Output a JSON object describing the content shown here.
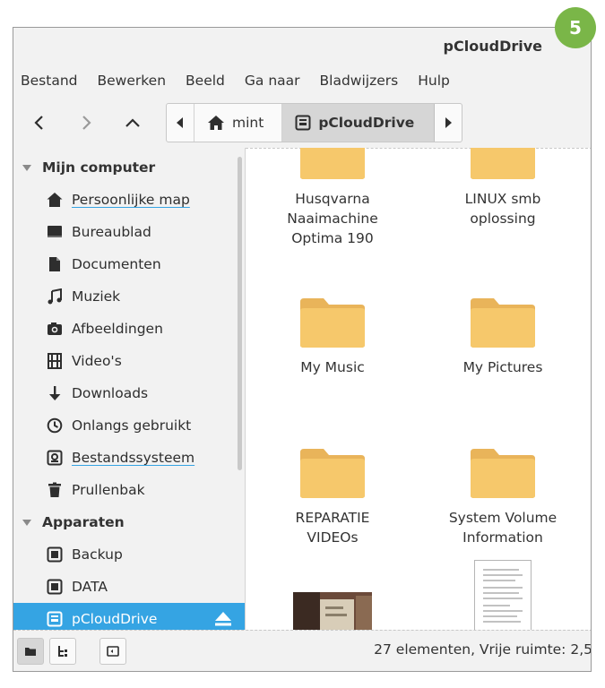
{
  "badge": "5",
  "window": {
    "title": "pCloudDrive"
  },
  "menu": [
    "Bestand",
    "Bewerken",
    "Beeld",
    "Ga naar",
    "Bladwijzers",
    "Hulp"
  ],
  "pathbar": {
    "crumbs": [
      "mint",
      "pCloudDrive"
    ]
  },
  "sidebar": {
    "headings": [
      "Mijn computer",
      "Apparaten"
    ],
    "computer_items": [
      "Persoonlijke map",
      "Bureaublad",
      "Documenten",
      "Muziek",
      "Afbeeldingen",
      "Video's",
      "Downloads",
      "Onlangs gebruikt",
      "Bestandssysteem",
      "Prullenbak"
    ],
    "device_items": [
      "Backup",
      "DATA",
      "pCloudDrive"
    ]
  },
  "files": [
    {
      "lines": [
        "Husqvarna",
        "Naaimachine",
        "Optima 190"
      ]
    },
    {
      "lines": [
        "LINUX smb",
        "oplossing"
      ]
    },
    {
      "lines": [
        "My Music"
      ]
    },
    {
      "lines": [
        "My Pictures"
      ]
    },
    {
      "lines": [
        "REPARATIE",
        "VIDEOs"
      ]
    },
    {
      "lines": [
        "System Volume",
        "Information"
      ]
    }
  ],
  "status": "27 elementen, Vrije ruimte: 2,5",
  "colors": {
    "accent": "#35a4e3",
    "folder": "#f6c86b",
    "badge": "#7ab648"
  }
}
